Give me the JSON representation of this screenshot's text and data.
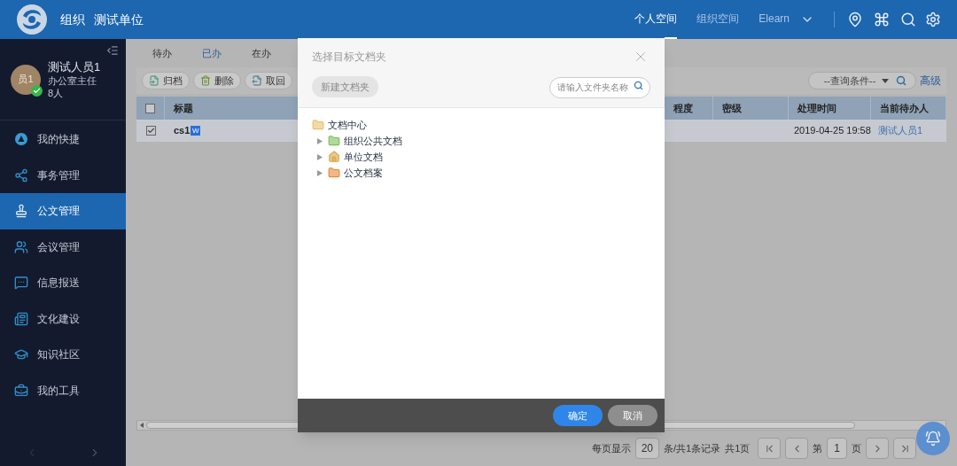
{
  "header": {
    "org": "组织",
    "unit": "测试单位",
    "nav": [
      {
        "label": "个人空间",
        "selected": true
      },
      {
        "label": "组织空间",
        "selected": false
      },
      {
        "label": "Elearn",
        "selected": false,
        "dropdown": true
      }
    ]
  },
  "user": {
    "avatar": "员1",
    "name": "测试人员1",
    "title": "办公室主任",
    "count": "8人",
    "online": true
  },
  "menu": [
    {
      "label": "我的快捷",
      "kind": "quick",
      "selected": false
    },
    {
      "label": "事务管理",
      "kind": "affairs",
      "selected": false
    },
    {
      "label": "公文管理",
      "kind": "document",
      "selected": true
    },
    {
      "label": "会议管理",
      "kind": "meeting",
      "selected": false
    },
    {
      "label": "信息报送",
      "kind": "message",
      "selected": false
    },
    {
      "label": "文化建设",
      "kind": "culture",
      "selected": false
    },
    {
      "label": "知识社区",
      "kind": "knowledge",
      "selected": false
    },
    {
      "label": "我的工具",
      "kind": "tools",
      "selected": false
    }
  ],
  "tabs": [
    {
      "label": "待办",
      "selected": false
    },
    {
      "label": "已办",
      "selected": true
    },
    {
      "label": "在办",
      "selected": false
    }
  ],
  "toolbar": [
    {
      "label": "归档",
      "kind": "archive"
    },
    {
      "label": "删除",
      "kind": "delete"
    },
    {
      "label": "取回",
      "kind": "retrieve"
    }
  ],
  "query": {
    "value": "--查询条件--",
    "advanced": "高级"
  },
  "table": {
    "header_checked": false,
    "columns": [
      "标题",
      "程度",
      "密级",
      "处理时间",
      "当前待办人"
    ],
    "rows": [
      {
        "checked": true,
        "title": "cs1",
        "file_badge": "W",
        "time": "2019-04-25 19:58",
        "handler": "测试人员1"
      }
    ]
  },
  "pagination": {
    "per_page_label": "每页显示",
    "per_page": "20",
    "records": "条/共1条记录",
    "pages": "共1页",
    "page_prefix": "第",
    "page": "1",
    "page_suffix": "页"
  },
  "dialog": {
    "title": "选择目标文档夹",
    "new_folder": "新建文档夹",
    "new_folder_disabled": true,
    "search_placeholder": "请输入文件夹名称",
    "tree": [
      {
        "label": "文档中心",
        "kind": "root",
        "expanded": true,
        "children": [
          {
            "label": "组织公共文档",
            "kind": "shared",
            "expanded": false
          },
          {
            "label": "单位文档",
            "kind": "unit",
            "expanded": false
          },
          {
            "label": "公文档案",
            "kind": "archive",
            "expanded": false
          }
        ]
      }
    ],
    "buttons": [
      {
        "label": "确定",
        "kind": "primary"
      },
      {
        "label": "取消",
        "kind": "secondary"
      }
    ]
  }
}
